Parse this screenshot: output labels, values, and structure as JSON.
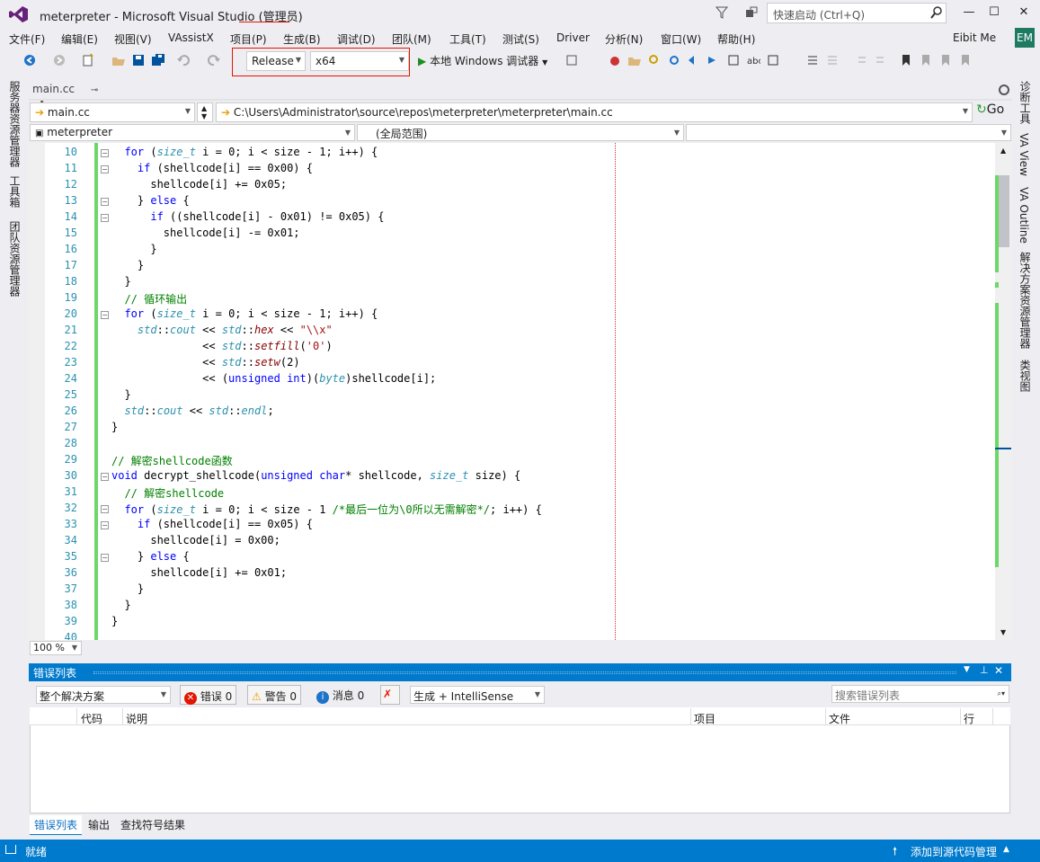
{
  "window": {
    "title": "meterpreter - Microsoft Visual Studio (管理员)",
    "quick_launch_placeholder": "快速启动 (Ctrl+Q)",
    "min": "—",
    "max": "☐",
    "close": "✕"
  },
  "menu": [
    "文件(F)",
    "编辑(E)",
    "视图(V)",
    "VAssistX",
    "项目(P)",
    "生成(B)",
    "调试(D)",
    "团队(M)",
    "工具(T)",
    "测试(S)",
    "Driver",
    "分析(N)",
    "窗口(W)",
    "帮助(H)"
  ],
  "account": {
    "name": "Eibit Me",
    "initials": "EM"
  },
  "toolbar": {
    "config": "Release",
    "platform": "x64",
    "run_label": "本地 Windows 调试器"
  },
  "tab": {
    "label": "main.cc",
    "pin": "⊸",
    "close": "✕"
  },
  "nav": {
    "file": "main.cc",
    "path": "C:\\Users\\Administrator\\source\\repos\\meterpreter\\meterpreter\\main.cc",
    "go": "Go"
  },
  "scope": {
    "project": "meterpreter",
    "range": "(全局范围)"
  },
  "editor": {
    "lines": [
      {
        "n": "10",
        "c": "  for (size_t i = 0; i < size - 1; i++) {"
      },
      {
        "n": "11",
        "c": "    if (shellcode[i] == 0x00) {"
      },
      {
        "n": "12",
        "c": "      shellcode[i] += 0x05;"
      },
      {
        "n": "13",
        "c": "    } else {"
      },
      {
        "n": "14",
        "c": "      if ((shellcode[i] - 0x01) != 0x05) {"
      },
      {
        "n": "15",
        "c": "        shellcode[i] -= 0x01;"
      },
      {
        "n": "16",
        "c": "      }"
      },
      {
        "n": "17",
        "c": "    }"
      },
      {
        "n": "18",
        "c": "  }"
      },
      {
        "n": "19",
        "c": "  // 循环输出"
      },
      {
        "n": "20",
        "c": "  for (size_t i = 0; i < size - 1; i++) {"
      },
      {
        "n": "21",
        "c": "    std::cout << std::hex << \"\\\\x\""
      },
      {
        "n": "22",
        "c": "              << std::setfill('0')"
      },
      {
        "n": "23",
        "c": "              << std::setw(2)"
      },
      {
        "n": "24",
        "c": "              << (unsigned int)(byte)shellcode[i];"
      },
      {
        "n": "25",
        "c": "  }"
      },
      {
        "n": "26",
        "c": "  std::cout << std::endl;"
      },
      {
        "n": "27",
        "c": "}"
      },
      {
        "n": "28",
        "c": ""
      },
      {
        "n": "29",
        "c": "// 解密shellcode函数"
      },
      {
        "n": "30",
        "c": "void decrypt_shellcode(unsigned char* shellcode, size_t size) {"
      },
      {
        "n": "31",
        "c": "  // 解密shellcode"
      },
      {
        "n": "32",
        "c": "  for (size_t i = 0; i < size - 1 /*最后一位为\\0所以无需解密*/; i++) {"
      },
      {
        "n": "33",
        "c": "    if (shellcode[i] == 0x05) {"
      },
      {
        "n": "34",
        "c": "      shellcode[i] = 0x00;"
      },
      {
        "n": "35",
        "c": "    } else {"
      },
      {
        "n": "36",
        "c": "      shellcode[i] += 0x01;"
      },
      {
        "n": "37",
        "c": "    }"
      },
      {
        "n": "38",
        "c": "  }"
      },
      {
        "n": "39",
        "c": "}"
      },
      {
        "n": "40",
        "c": ""
      }
    ],
    "zoom": "100 %"
  },
  "error_list": {
    "title": "错误列表",
    "scope": "整个解决方案",
    "errors": "错误 0",
    "warnings": "警告 0",
    "messages": "消息 0",
    "build": "生成 + IntelliSense",
    "search_placeholder": "搜索错误列表",
    "columns": [
      "代码",
      "说明",
      "项目",
      "文件",
      "行"
    ]
  },
  "bottom_tabs": [
    "错误列表",
    "输出",
    "查找符号结果"
  ],
  "status": {
    "text": "就绪",
    "scc": "添加到源代码管理"
  },
  "left_side": [
    "服务器资源管理器",
    "工具箱",
    "团队资源管理器"
  ],
  "right_side": [
    "诊断工具",
    "VA View",
    "VA Outline",
    "解决方案资源管理器",
    "类视图"
  ]
}
